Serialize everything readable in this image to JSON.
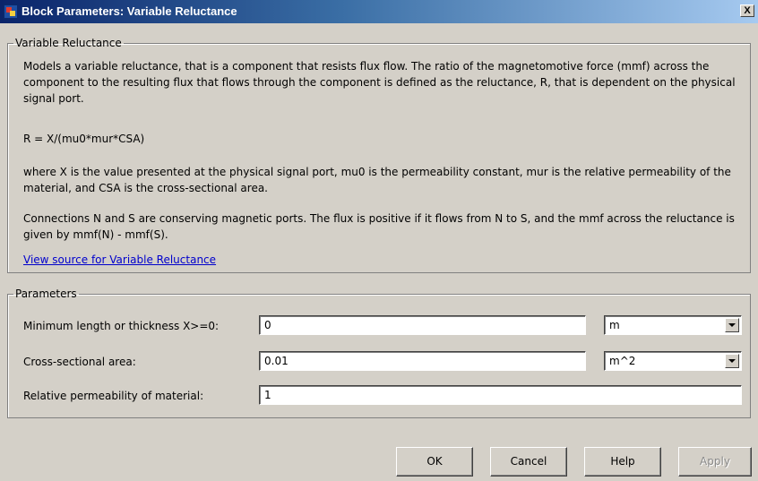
{
  "window": {
    "title": "Block Parameters: Variable Reluctance",
    "close_label": "X"
  },
  "description_group": {
    "legend": "Variable Reluctance",
    "paragraphs": [
      "Models a variable reluctance, that is a component that resists flux flow. The ratio of the magnetomotive force (mmf) across the component to the resulting flux that flows through the component is defined as the reluctance, R, that is dependent on the physical signal port.",
      "R = X/(mu0*mur*CSA)",
      "where X is the value presented at the physical signal port, mu0 is the permeability constant, mur is the relative permeability of the material, and CSA is the cross-sectional area.",
      "Connections N and S are conserving magnetic ports. The flux is positive if it flows from N to S, and the mmf across the reluctance is given by mmf(N) - mmf(S)."
    ],
    "link_text": "View source for Variable Reluctance"
  },
  "parameters_group": {
    "legend": "Parameters",
    "rows": [
      {
        "label": "Minimum length or thickness X>=0:",
        "value": "0",
        "unit": "m"
      },
      {
        "label": "Cross-sectional area:",
        "value": "0.01",
        "unit": "m^2"
      },
      {
        "label": "Relative permeability of material:",
        "value": "1"
      }
    ]
  },
  "buttons": {
    "ok": "OK",
    "cancel": "Cancel",
    "help": "Help",
    "apply": "Apply"
  },
  "colors": {
    "dialog_bg": "#d4d0c8",
    "title_gradient_start": "#0a246a",
    "title_gradient_end": "#a6caf0",
    "link": "#0000cc"
  },
  "icons": {
    "app_icon": "simulink-block-icon",
    "close_icon": "close-icon",
    "dropdown_icon": "chevron-down-icon"
  }
}
